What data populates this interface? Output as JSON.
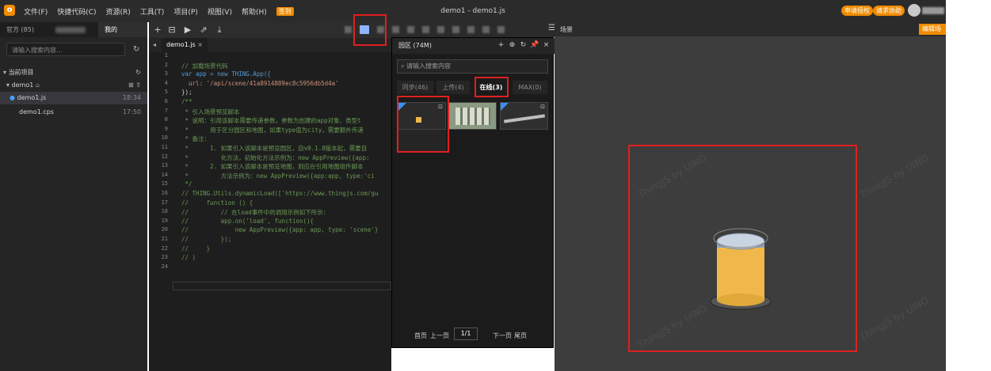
{
  "menubar": {
    "logo_glyph": "o",
    "menu_items": [
      "文件(F)",
      "快捷代码(C)",
      "资源(R)",
      "工具(T)",
      "项目(P)",
      "视图(V)",
      "帮助(H)"
    ],
    "badge": "签到",
    "window_title": "demo1 - demo1.js",
    "right_buttons": [
      "申请授权",
      "请求协助"
    ]
  },
  "left_panel": {
    "tabs": [
      "官方 (85)",
      "我的"
    ],
    "search_placeholder": "请输入搜索内容...",
    "section_title": "当前项目",
    "project": "demo1",
    "files": [
      {
        "name": "demo1.js",
        "time": "18:34"
      },
      {
        "name": "demo1.cps",
        "time": "17:50"
      }
    ]
  },
  "editor": {
    "toolbar_icons": [
      "+",
      "⊟",
      "▶",
      "⇗",
      "⤓"
    ],
    "file_tab": "demo1.js",
    "file_tab_close": "×",
    "lines": [
      {
        "n": "1",
        "t": "",
        "c": "c-txt"
      },
      {
        "n": "2",
        "t": "// 加载场景代码",
        "c": "c-com"
      },
      {
        "n": "3",
        "t": "var app = new THING.App({",
        "c": "c-kw"
      },
      {
        "n": "4",
        "t": "  url: '/api/scene/41a8914889ec8c5956db5d4a'",
        "c": "c-str"
      },
      {
        "n": "5",
        "t": "});",
        "c": "c-txt"
      },
      {
        "n": "6",
        "t": "/**",
        "c": "c-com"
      },
      {
        "n": "7",
        "t": " * 引入场景预览脚本",
        "c": "c-com"
      },
      {
        "n": "8",
        "t": " * 说明：引用该脚本需要传递参数，参数为创建的app对象、类型t",
        "c": "c-com"
      },
      {
        "n": "9",
        "t": " *      用于区分园区和地图，如果type值为city，需要额外传递",
        "c": "c-com"
      },
      {
        "n": "10",
        "t": " * 备注：",
        "c": "c-com"
      },
      {
        "n": "11",
        "t": " *      1. 如果引入该脚本是预览园区，自v0.1.8版本起，需要自",
        "c": "c-com"
      },
      {
        "n": "12",
        "t": " *         化方法，初始化方法示例为：new AppPreview({app:",
        "c": "c-com"
      },
      {
        "n": "13",
        "t": " *      2. 如果引入该脚本是预览地图，则应在引用地图组件脚本",
        "c": "c-com"
      },
      {
        "n": "14",
        "t": " *         方法示例为：new AppPreview({app:app, type:'ci",
        "c": "c-com"
      },
      {
        "n": "15",
        "t": " */",
        "c": "c-com"
      },
      {
        "n": "16",
        "t": "// THING.Utils.dynamicLoad(['https://www.thingjs.com/gu",
        "c": "c-com"
      },
      {
        "n": "17",
        "t": "//     function () {",
        "c": "c-com"
      },
      {
        "n": "18",
        "t": "//         // 在load事件中的调用示例如下所示：",
        "c": "c-com"
      },
      {
        "n": "19",
        "t": "//         app.on('load', function(){",
        "c": "c-com"
      },
      {
        "n": "20",
        "t": "//             new AppPreview({app: app, type: 'scene'}",
        "c": "c-com"
      },
      {
        "n": "21",
        "t": "//         });",
        "c": "c-com"
      },
      {
        "n": "22",
        "t": "//     }",
        "c": "c-com"
      },
      {
        "n": "23",
        "t": "// )",
        "c": "c-com"
      },
      {
        "n": "24",
        "t": "",
        "c": "c-txt"
      }
    ]
  },
  "popup": {
    "title": "园区 (74M)",
    "icons": [
      "+",
      "⊕",
      "↻",
      "📌",
      "×"
    ],
    "search_placeholder": "请输入搜索内容",
    "tabs": [
      "同步(46)",
      "上传(4)",
      "在线(3)",
      "MAX(0)"
    ],
    "pager": {
      "first": "首页",
      "prev": "上一页",
      "page": "1/1",
      "next": "下一页",
      "last": "尾页"
    }
  },
  "scene": {
    "label": "场景",
    "edit_button": "编辑场景",
    "watermark": "ThingJS by UINO"
  },
  "colors": {
    "accent": "#f08c00",
    "highlight": "#e02020"
  }
}
